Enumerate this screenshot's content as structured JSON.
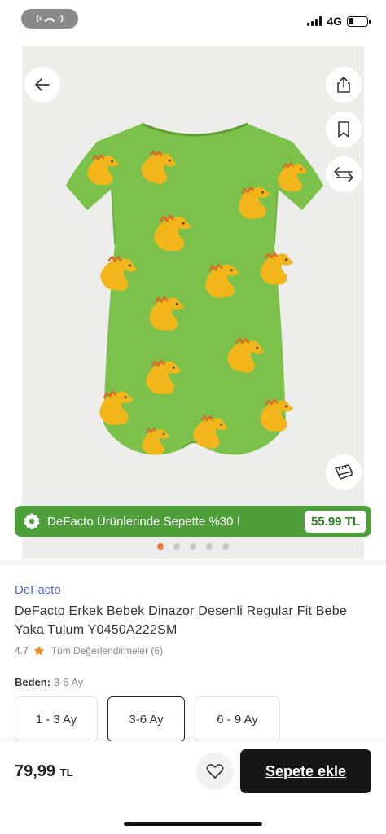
{
  "status_bar": {
    "network": "4G",
    "signal_bars": 4,
    "battery_level": 0.25
  },
  "gallery": {
    "promo_text": "DeFacto Ürünlerinde Sepette %30 !",
    "promo_price": "55.99 TL",
    "image_count": 5,
    "active_index": 0
  },
  "product": {
    "brand": "DeFacto",
    "title": "DeFacto Erkek Bebek Dinazor Desenli Regular Fit Bebe Yaka Tulum Y0450A222SM",
    "rating": "4.7",
    "reviews_label": "Tüm Değerlendirmeler (6)"
  },
  "size": {
    "label": "Beden:",
    "selected": "3-6 Ay",
    "options": [
      "1 - 3 Ay",
      "3-6 Ay",
      "6 - 9 Ay"
    ]
  },
  "footer": {
    "price": "79,99",
    "currency": "TL",
    "cart_label": "Sepete ekle"
  },
  "colors": {
    "promo_green": "#4e9e3a",
    "romper_green": "#7cc24a",
    "dino_yellow": "#f2b51a",
    "accent_orange": "#f07a3a",
    "brand_link": "#5a66d6"
  },
  "icons": [
    "phone-icon",
    "back-arrow-icon",
    "share-icon",
    "bookmark-icon",
    "compare-icon",
    "size-guide-icon",
    "discount-badge-icon",
    "star-icon",
    "heart-icon"
  ]
}
